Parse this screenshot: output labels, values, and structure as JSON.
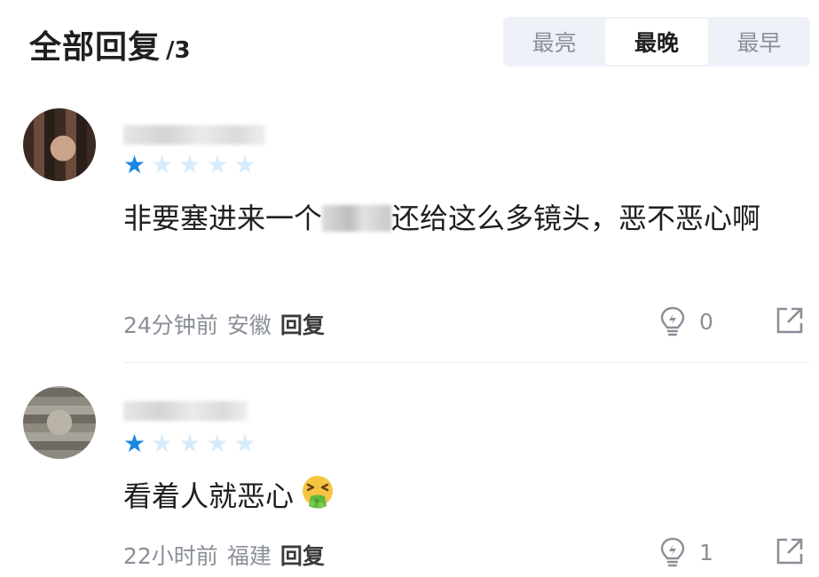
{
  "header": {
    "title": "全部回复",
    "count": "/3",
    "sort_tabs": [
      {
        "label": "最亮",
        "active": false
      },
      {
        "label": "最晚",
        "active": true
      },
      {
        "label": "最早",
        "active": false
      }
    ]
  },
  "comments": [
    {
      "rating": 1,
      "rating_max": 5,
      "text_before": "非要塞进来一个",
      "text_after": "还给这么多镜头，恶不恶心啊",
      "time": "24分钟前",
      "location": "安徽",
      "reply_label": "回复",
      "likes": "0"
    },
    {
      "rating": 1,
      "rating_max": 5,
      "text_before": "看着人就恶心",
      "emoji": "nauseated-vomiting-face",
      "time": "22小时前",
      "location": "福建",
      "reply_label": "回复",
      "likes": "1"
    }
  ],
  "colors": {
    "star_on": "#1a86e0",
    "star_off": "#d7ecfb",
    "muted_text": "#8a8f98",
    "sort_bg": "#eef2f8"
  }
}
